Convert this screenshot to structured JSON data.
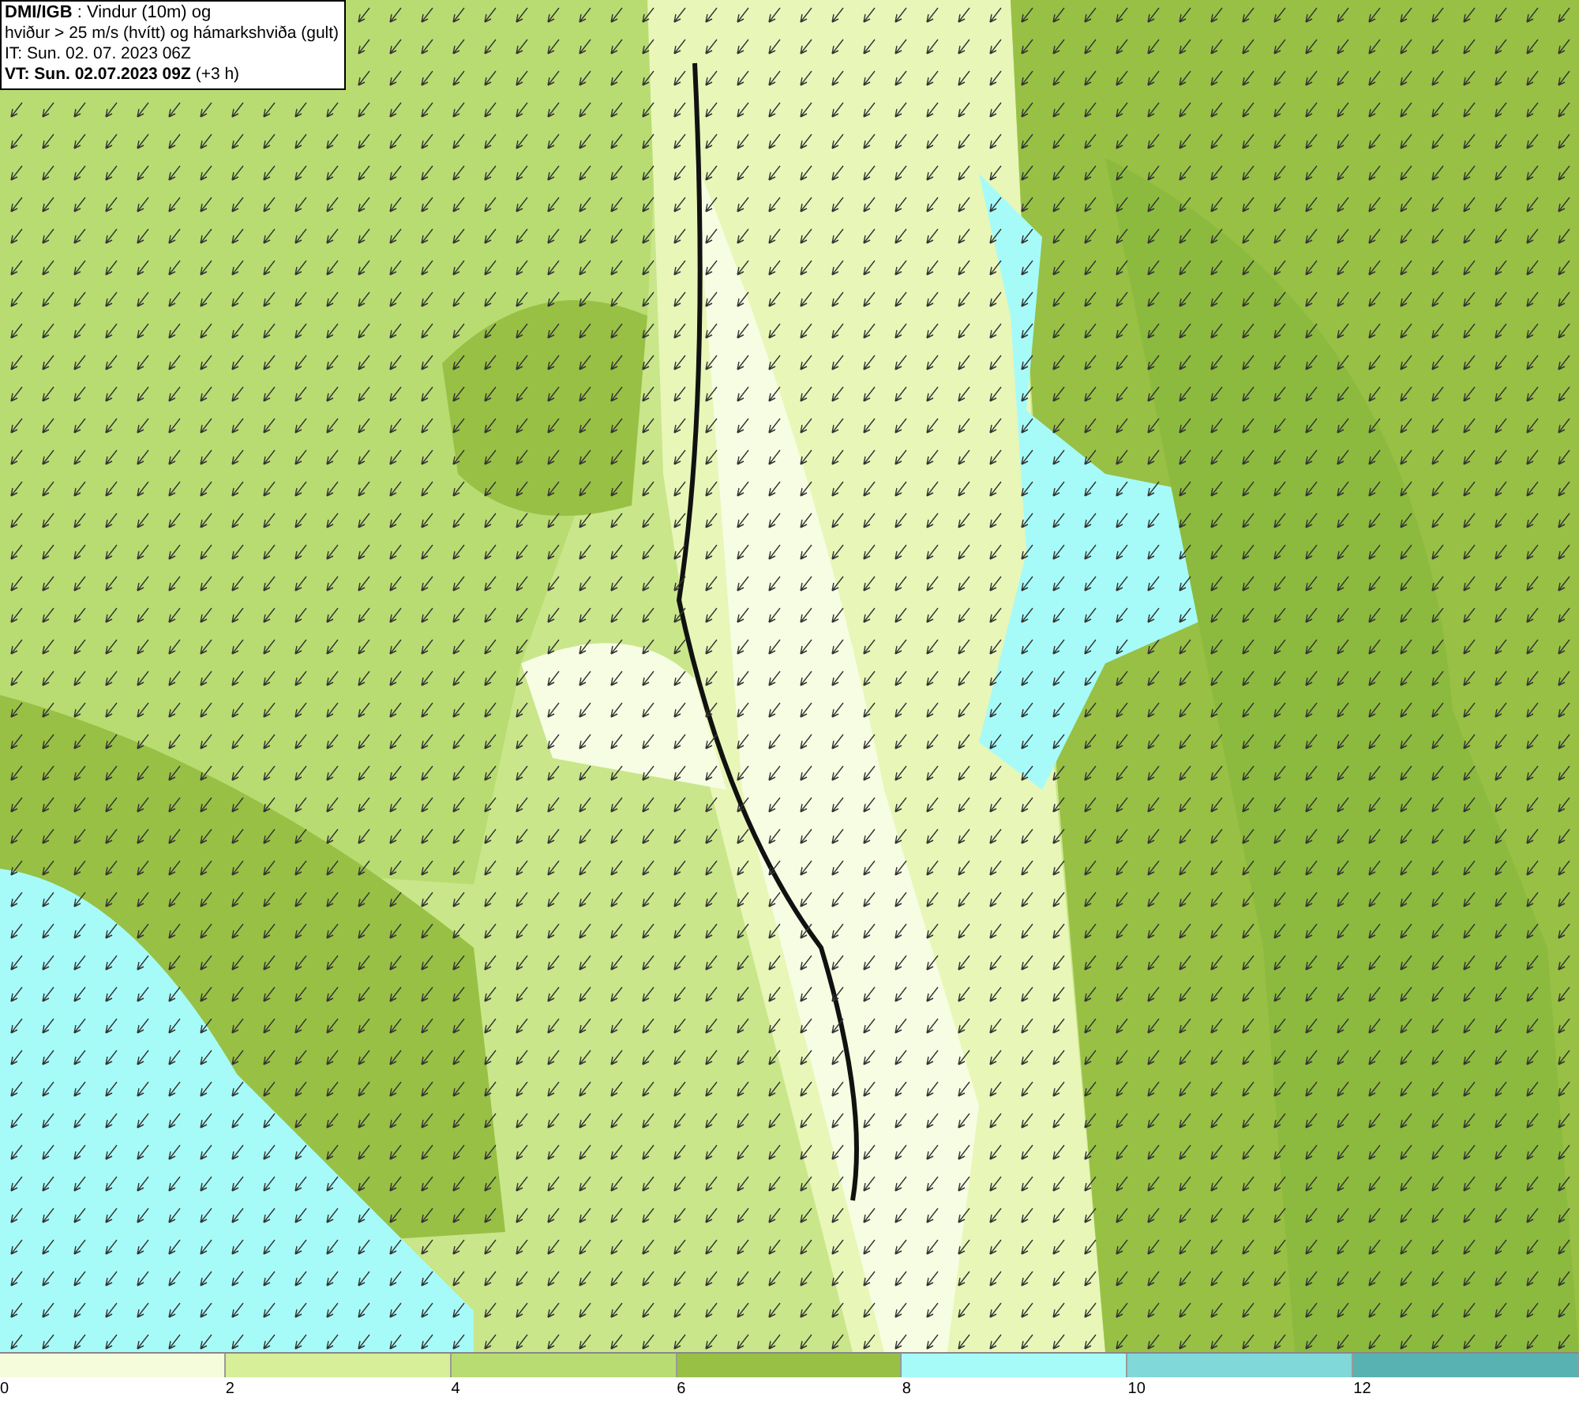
{
  "title_box": {
    "lines": [
      "**DMI/IGB** : Vindur (10m) og",
      "hviður > 25 m/s (hvítt) og hámarkshviða (gult)",
      "IT: Sun. 02. 07. 2023 06Z",
      "**VT: Sun. 02.07.2023 09Z** (+3 h)"
    ]
  },
  "legend": {
    "bins": [
      {
        "color": "#f4fcdc"
      },
      {
        "color": "#d6ef98"
      },
      {
        "color": "#b8dc72"
      },
      {
        "color": "#98c045"
      },
      {
        "color": "#a6fbf8"
      },
      {
        "color": "#80d8d8"
      },
      {
        "color": "#58b2b2"
      }
    ],
    "ticks": [
      "0",
      "2",
      "4",
      "6",
      "8",
      "10",
      "12"
    ]
  }
}
